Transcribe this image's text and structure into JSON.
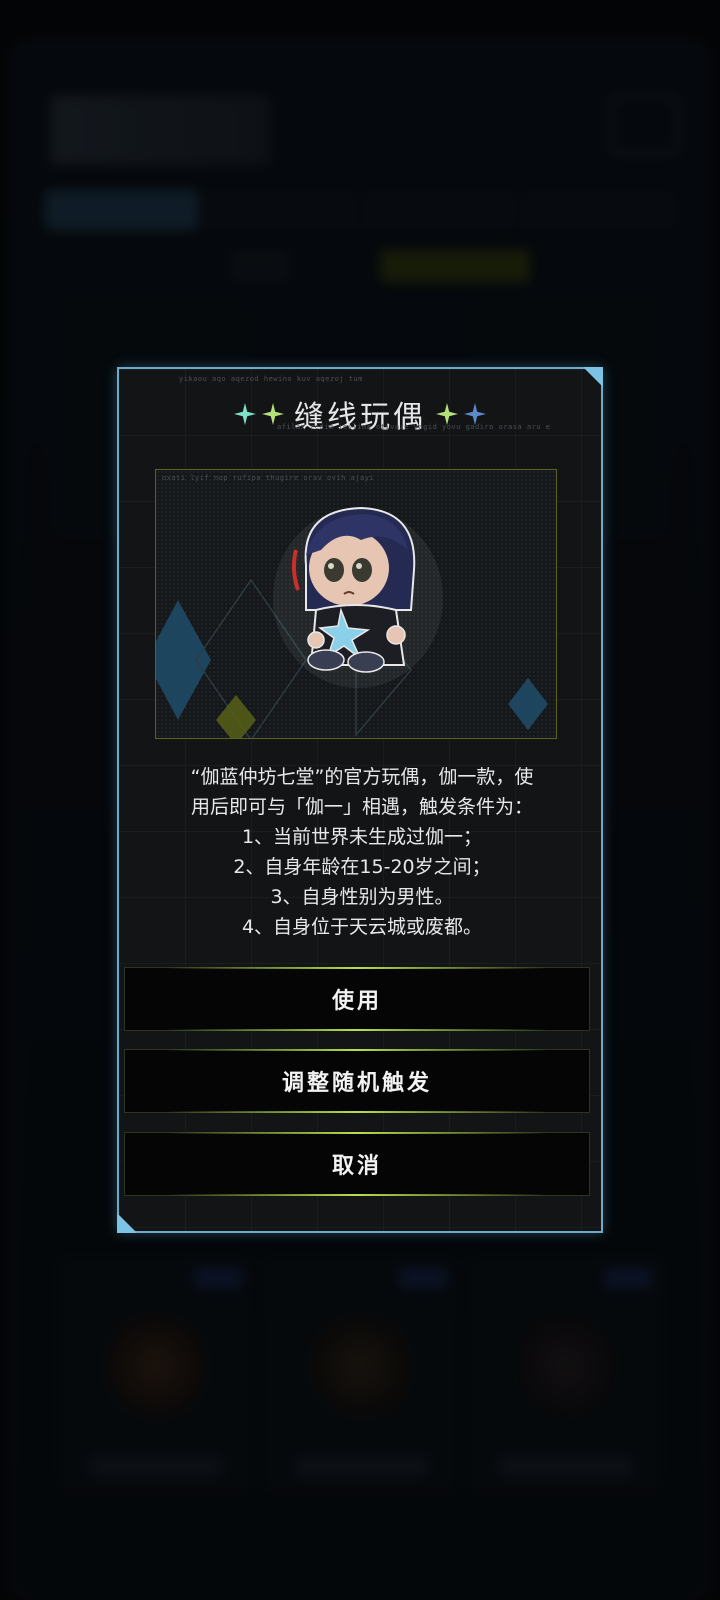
{
  "modal": {
    "title": "缝线玩偶",
    "tiny_top": "yikaou aqo aqezod hewino kuv aqezoj tum",
    "tiny_sub": "afilax zedim ieslima otivaze vagid yovu gadiro orasa aru e",
    "image_caption": "oxati lyif nop rufipa thugire orav ovih ajayi",
    "description": [
      "“伽蓝仲坊七堂”的官方玩偶，伽一款，使",
      "用后即可与「伽一」相遇，触发条件为：",
      "1、当前世界未生成过伽一；",
      "2、自身年龄在15-20岁之间；",
      "3、自身性别为男性。",
      "4、自身位于天云城或废都。"
    ],
    "buttons": {
      "use": "使用",
      "adjust": "调整随机触发",
      "cancel": "取消"
    },
    "icons": [
      "sparkle-icon",
      "doll-image"
    ],
    "colors": {
      "border": "#6fa8c8",
      "accent_green": "#b8e04a",
      "star_cyan": "#7de0c8",
      "star_green": "#b6e07a",
      "star_blue": "#5b8ac8"
    }
  }
}
